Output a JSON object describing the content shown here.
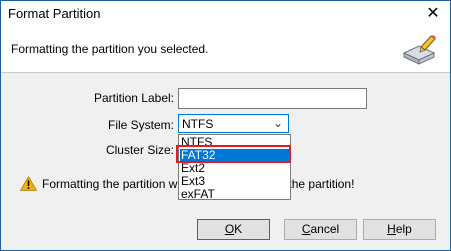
{
  "window": {
    "title": "Format Partition"
  },
  "header": {
    "text": "Formatting the partition you selected."
  },
  "form": {
    "partition_label": {
      "label": "Partition Label:",
      "value": ""
    },
    "file_system": {
      "label": "File System:",
      "value": "NTFS",
      "options": [
        "NTFS",
        "FAT32",
        "Ext2",
        "Ext3",
        "exFAT"
      ],
      "highlighted": "FAT32"
    },
    "cluster_size": {
      "label": "Cluster Size:"
    }
  },
  "warning": {
    "text_start": "Formatting the partition will",
    "text_end": "n the partition!"
  },
  "buttons": {
    "ok": {
      "access": "O",
      "rest": "K"
    },
    "cancel": {
      "access": "C",
      "rest": "ancel"
    },
    "help": {
      "access": "H",
      "rest": "elp"
    }
  },
  "colors": {
    "selection": "#0078d7",
    "highlight_box": "#e01b24",
    "dialog_bg": "#f0f0f0"
  }
}
